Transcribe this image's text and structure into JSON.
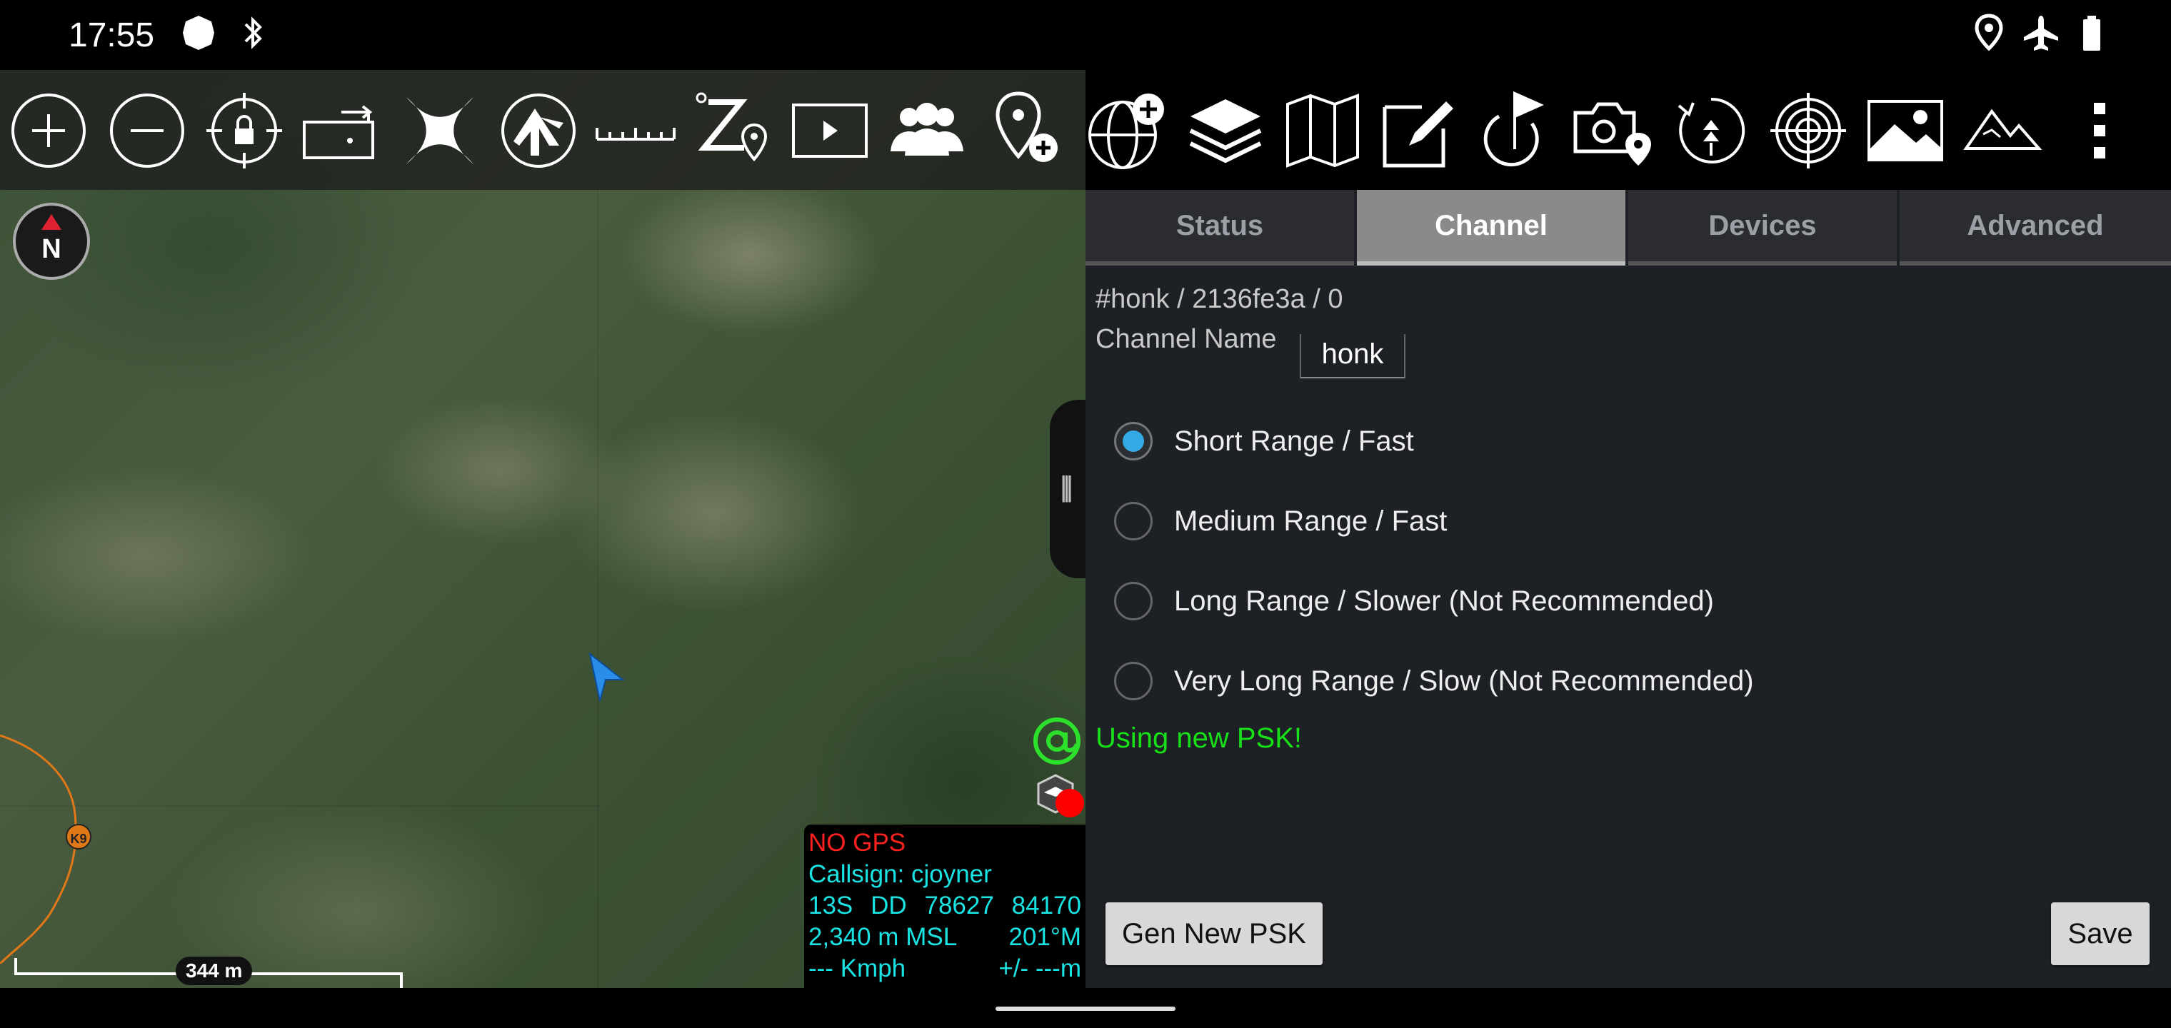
{
  "status_bar": {
    "time": "17:55",
    "left_icons": [
      "shield-badge-icon",
      "bluetooth-icon"
    ],
    "right_icons": [
      "location-icon",
      "airplane-mode-icon",
      "battery-icon"
    ]
  },
  "map_toolbar": {
    "buttons": [
      "zoom-in",
      "zoom-out",
      "lock-on-self",
      "rotate-map",
      "close-x",
      "atak-logo",
      "measure-ruler",
      "elevation-route",
      "video-play",
      "contacts-group",
      "add-waypoint"
    ]
  },
  "right_toolbar": {
    "buttons": [
      "import-globe",
      "overlay-layers",
      "map-manager",
      "drawing-tools",
      "route-flag",
      "geo-camera",
      "bloodhound",
      "target-scope",
      "image-gallery",
      "elevation-terrain",
      "overflow-menu"
    ]
  },
  "map": {
    "compass_label": "N",
    "track_marker_label": "K9",
    "info": {
      "gps_status": "NO GPS",
      "callsign": "Callsign: cjoyner",
      "grid_zone": "13S",
      "grid_square": "DD",
      "easting": "78627",
      "northing": "84170",
      "altitude": "2,340 m MSL",
      "heading": "201°M",
      "speed": "--- Kmph",
      "accuracy": "+/- ---m"
    },
    "scale_label": "344 m"
  },
  "panel": {
    "tabs": [
      {
        "label": "Status",
        "active": false
      },
      {
        "label": "Channel",
        "active": true
      },
      {
        "label": "Devices",
        "active": false
      },
      {
        "label": "Advanced",
        "active": false
      }
    ],
    "channel_path": "#honk / 2136fe3a / 0",
    "channel_name_label": "Channel Name",
    "channel_name_value": "honk",
    "range_options": [
      {
        "label": "Short Range / Fast",
        "selected": true
      },
      {
        "label": "Medium Range / Fast",
        "selected": false
      },
      {
        "label": "Long Range / Slower (Not Recommended)",
        "selected": false
      },
      {
        "label": "Very Long Range / Slow (Not Recommended)",
        "selected": false
      }
    ],
    "psk_message": "Using new PSK!",
    "gen_psk_button": "Gen New PSK",
    "save_button": "Save"
  },
  "colors": {
    "accent_radio": "#33a9e6",
    "psk_message": "#18e018",
    "nogps": "#ff2020",
    "info_text": "#19e3e3"
  }
}
